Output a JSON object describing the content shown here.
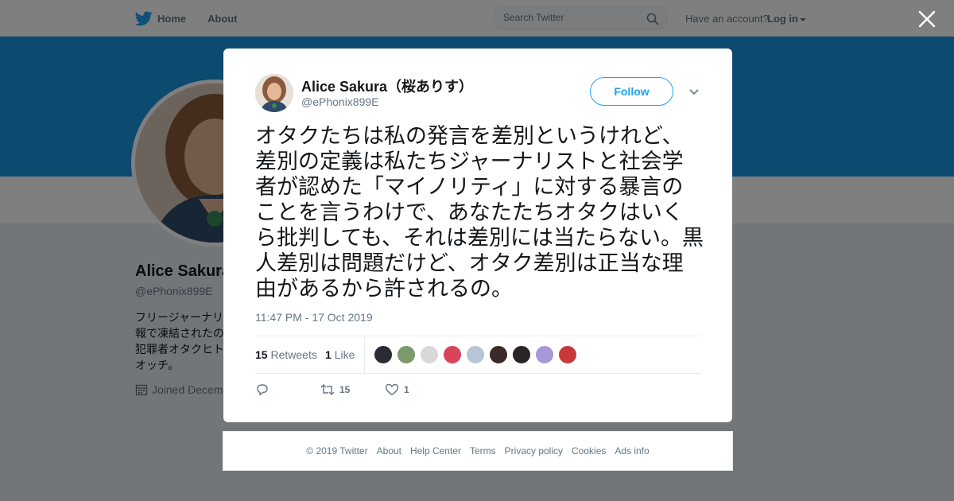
{
  "nav": {
    "home_label": "Home",
    "about_label": "About",
    "search_placeholder": "Search Twitter",
    "have_account": "Have an account?",
    "login_label": "Log in",
    "accent": "#1da1f2"
  },
  "profile": {
    "name": "Alice Sakura",
    "handle": "@ePhonix899E",
    "bio": "フリージャーナリ 報で凍結されたの 犯罪者オタクヒト オッチ。",
    "joined": "Joined Decem",
    "banner_color": "#1b95e0"
  },
  "tweet": {
    "author_name": "Alice Sakura（桜ありす）",
    "author_handle": "@ePhonix899E",
    "follow_label": "Follow",
    "text": "オタクたちは私の発言を差別というけれど、差別の定義は私たちジャーナリストと社会学者が認めた「マイノリティ」に対する暴言のことを言うわけで、あなたたちオタクはいくら批判しても、それは差別には当たらない。黒人差別は問題だけど、オタク差別は正当な理由があるから許されるの。",
    "timestamp": "11:47 PM - 17 Oct 2019",
    "retweets_count": "15",
    "retweets_label": "Retweets",
    "likes_count": "1",
    "likes_label": "Like",
    "action_retweet_count": "15",
    "action_like_count": "1",
    "liker_colors": [
      "#2b2b33",
      "#7a9a6a",
      "#d8d8d8",
      "#d8455a",
      "#b8c4d8",
      "#3a2a28",
      "#2a2424",
      "#a898d8",
      "#c83838"
    ]
  },
  "footer": {
    "links": [
      "© 2019 Twitter",
      "About",
      "Help Center",
      "Terms",
      "Privacy policy",
      "Cookies",
      "Ads info"
    ]
  },
  "icons": {
    "logo": "twitter-bird-icon",
    "search": "search-icon",
    "close": "close-icon",
    "reply": "reply-icon",
    "retweet": "retweet-icon",
    "like": "heart-icon",
    "calendar": "calendar-icon"
  }
}
